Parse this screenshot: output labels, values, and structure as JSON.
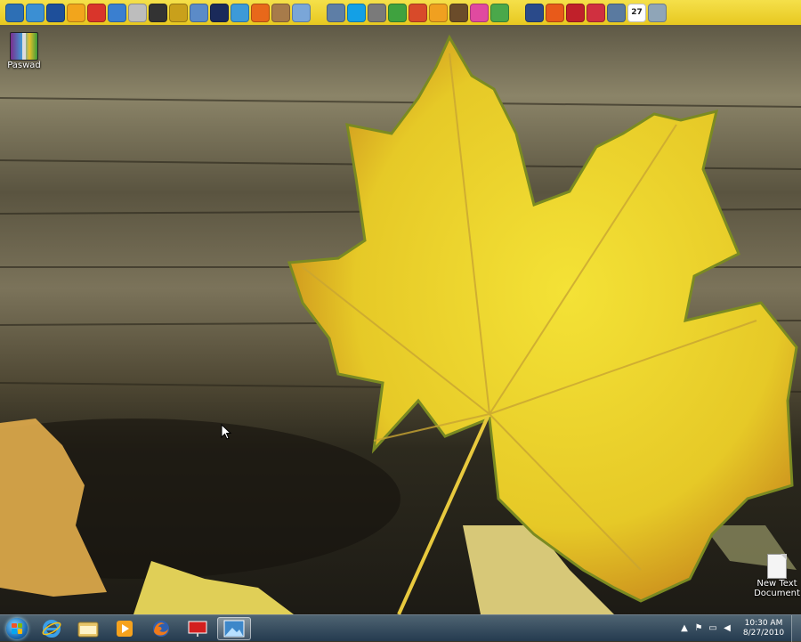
{
  "desktop": {
    "icons": [
      {
        "name": "rar-archive-icon",
        "label": "Paswad"
      },
      {
        "name": "text-document-icon",
        "label": "New Text Document"
      }
    ]
  },
  "dock": {
    "icons": [
      "computer-icon",
      "network-icon",
      "monitor-icon",
      "folder-icon",
      "ccleaner-icon",
      "disc-icon",
      "cd-icon",
      "media-icon",
      "archive-icon",
      "picture-icon",
      "image-icon",
      "opera-icon",
      "firefox-icon",
      "box-icon",
      "document-icon",
      "search-icon",
      "skype-icon",
      "drive-icon",
      "users-icon",
      "red-icon",
      "vlc-icon",
      "photo-icon",
      "pink-icon",
      "green-icon",
      "image2-icon",
      "orange-icon",
      "star-icon",
      "chrome-icon",
      "settings-icon",
      "calendar-icon",
      "recycle-bin-icon"
    ],
    "calendar_day": "27"
  },
  "taskbar": {
    "pinned": [
      {
        "name": "internet-explorer-icon"
      },
      {
        "name": "windows-explorer-icon"
      },
      {
        "name": "media-player-icon"
      },
      {
        "name": "firefox-icon"
      },
      {
        "name": "presentation-icon"
      },
      {
        "name": "photo-viewer-icon",
        "active": true
      }
    ]
  },
  "tray": {
    "time": "10:30 AM",
    "date": "8/27/2010"
  }
}
